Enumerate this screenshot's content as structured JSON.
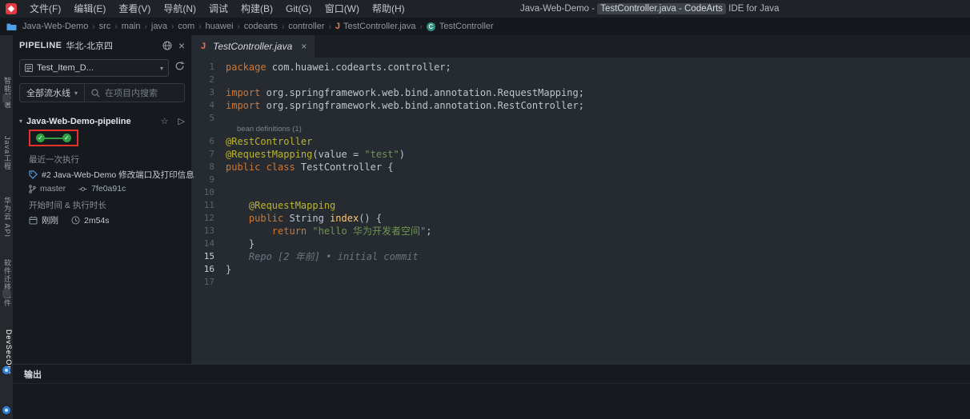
{
  "titlebar": {
    "menus": [
      "文件(F)",
      "编辑(E)",
      "查看(V)",
      "导航(N)",
      "调试",
      "构建(B)",
      "Git(G)",
      "窗口(W)",
      "帮助(H)"
    ],
    "title_pre": "Java-Web-Demo - ",
    "title_highlight": "TestController.java - CodeArts",
    "title_post": " IDE for Java"
  },
  "breadcrumb": {
    "items": [
      "Java-Web-Demo",
      "src",
      "main",
      "java",
      "com",
      "huawei",
      "codearts",
      "controller"
    ],
    "file": "TestController.java",
    "symbol": "TestController"
  },
  "activitybar": {
    "items": [
      {
        "label": "智能部署",
        "active": false
      },
      {
        "label": "Java工程",
        "active": false
      },
      {
        "label": "华为云 API",
        "active": false
      },
      {
        "label": "软件迁移插件",
        "active": false
      },
      {
        "label": "DevSecOps",
        "active": true
      }
    ]
  },
  "sidebar": {
    "title": "PIPELINE",
    "region": "华北-北京四",
    "project_select": "Test_Item_D...",
    "filter_label": "全部流水线",
    "search_placeholder": "在项目内搜索",
    "pipeline_name": "Java-Web-Demo-pipeline",
    "last_run_label": "最近一次执行",
    "run_title": "#2 Java-Web-Demo 修改端口及打印信息",
    "branch": "master",
    "commit": "7fe0a91c",
    "time_label": "开始时间 & 执行时长",
    "start_time": "刚刚",
    "duration": "2m54s"
  },
  "editor": {
    "tab": "TestController.java",
    "lines": [
      {
        "n": 1,
        "segs": [
          [
            "kw",
            "package "
          ],
          [
            "def",
            "com.huawei.codearts.controller;"
          ]
        ]
      },
      {
        "n": 2,
        "segs": []
      },
      {
        "n": 3,
        "segs": [
          [
            "kw",
            "import "
          ],
          [
            "def",
            "org.springframework.web.bind.annotation.RequestMapping;"
          ]
        ]
      },
      {
        "n": 4,
        "segs": [
          [
            "kw",
            "import "
          ],
          [
            "def",
            "org.springframework.web.bind.annotation.RestController;"
          ]
        ]
      },
      {
        "n": 5,
        "segs": []
      },
      {
        "lens": "bean definitions (1)"
      },
      {
        "n": 6,
        "segs": [
          [
            "ann",
            "@RestController"
          ]
        ]
      },
      {
        "n": 7,
        "segs": [
          [
            "ann",
            "@RequestMapping"
          ],
          [
            "def",
            "(value = "
          ],
          [
            "str",
            "\"test\""
          ],
          [
            "def",
            ")"
          ]
        ]
      },
      {
        "n": 8,
        "segs": [
          [
            "kw",
            "public class "
          ],
          [
            "def",
            "TestController {"
          ]
        ]
      },
      {
        "n": 9,
        "segs": []
      },
      {
        "n": 10,
        "segs": []
      },
      {
        "n": 11,
        "segs": [
          [
            "def",
            "    "
          ],
          [
            "ann",
            "@RequestMapping"
          ]
        ]
      },
      {
        "n": 12,
        "segs": [
          [
            "def",
            "    "
          ],
          [
            "kw",
            "public "
          ],
          [
            "def",
            "String "
          ],
          [
            "fn",
            "index"
          ],
          [
            "def",
            "() {"
          ]
        ]
      },
      {
        "n": 13,
        "segs": [
          [
            "def",
            "        "
          ],
          [
            "kw",
            "return "
          ],
          [
            "str",
            "\"hello 华为开发者空间\""
          ],
          [
            "def",
            ";"
          ]
        ]
      },
      {
        "n": 14,
        "segs": [
          [
            "def",
            "    }"
          ]
        ]
      },
      {
        "n": 15,
        "segs": [
          [
            "blame",
            "    Repo [2 年前] • initial commit"
          ]
        ],
        "active": true
      },
      {
        "n": 16,
        "segs": [
          [
            "def",
            "}"
          ]
        ],
        "active": true
      },
      {
        "n": 17,
        "segs": []
      }
    ]
  },
  "panel": {
    "title": "输出"
  },
  "icons": {
    "close": "×",
    "caret_down": "▾",
    "chevron": "›",
    "star": "☆",
    "play": "▷",
    "check": "✓",
    "java_file": "J",
    "class_symbol": "C"
  },
  "colors": {
    "accent_green": "#2ea043",
    "annotation_red": "#e8312a",
    "keyword_orange": "#cc7832",
    "annotation_yellow": "#bbb529",
    "string_green": "#6f9454",
    "logo_red": "#e23a3f",
    "link_blue": "#4d9fea"
  }
}
